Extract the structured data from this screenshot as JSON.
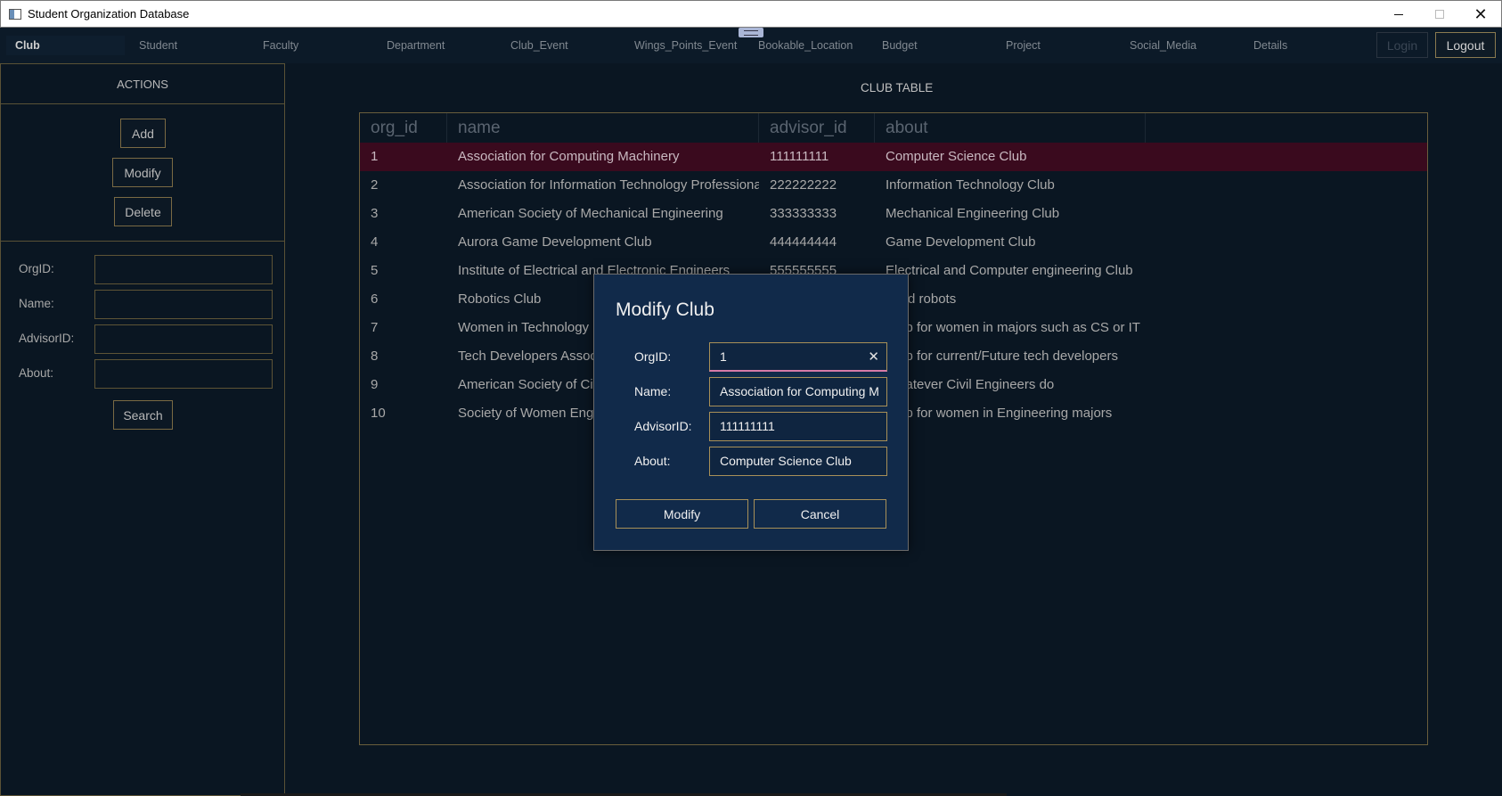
{
  "window": {
    "title": "Student Organization Database"
  },
  "tabs": [
    "Club",
    "Student",
    "Faculty",
    "Department",
    "Club_Event",
    "Wings_Points_Event",
    "Bookable_Location",
    "Budget",
    "Project",
    "Social_Media",
    "Details"
  ],
  "auth": {
    "login": "Login",
    "logout": "Logout"
  },
  "sidebar": {
    "actions_title": "ACTIONS",
    "buttons": {
      "add": "Add",
      "modify": "Modify",
      "delete": "Delete",
      "search": "Search"
    },
    "fields": {
      "org_id": "OrgID:",
      "name": "Name:",
      "advisor_id": "AdvisorID:",
      "about": "About:"
    }
  },
  "table": {
    "title": "CLUB TABLE",
    "columns": [
      "org_id",
      "name",
      "advisor_id",
      "about"
    ],
    "rows": [
      [
        "1",
        "Association for Computing Machinery",
        "111111111",
        "Computer Science Club"
      ],
      [
        "2",
        "Association for Information Technology Professiona",
        "222222222",
        "Information Technology Club"
      ],
      [
        "3",
        "American Society of Mechanical Engineering",
        "333333333",
        "Mechanical Engineering Club"
      ],
      [
        "4",
        "Aurora Game Development Club",
        "444444444",
        "Game Development Club"
      ],
      [
        "5",
        "Institute of Electrical and Electronic Engineers",
        "555555555",
        "Electrical and Computer engineering Club"
      ],
      [
        "6",
        "Robotics Club",
        "",
        "Build robots"
      ],
      [
        "7",
        "Women in Technology",
        "",
        "Club for women in majors such as CS or IT"
      ],
      [
        "8",
        "Tech Developers Assoc",
        "",
        "Club for current/Future tech developers"
      ],
      [
        "9",
        "American Society of Civ",
        "",
        "Whatever Civil Engineers do"
      ],
      [
        "10",
        "Society of Women Eng",
        "",
        "Club for women in Engineering majors"
      ]
    ]
  },
  "modal": {
    "title": "Modify Club",
    "labels": {
      "org_id": "OrgID:",
      "name": "Name:",
      "advisor_id": "AdvisorID:",
      "about": "About:"
    },
    "values": {
      "org_id": "1",
      "name": "Association for Computing M",
      "advisor_id": "111111111",
      "about": "Computer Science Club"
    },
    "buttons": {
      "modify": "Modify",
      "cancel": "Cancel"
    }
  }
}
